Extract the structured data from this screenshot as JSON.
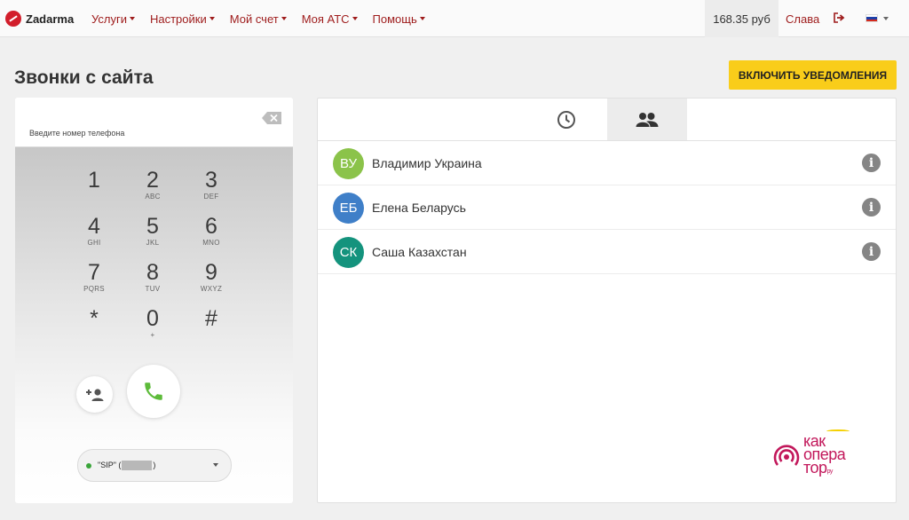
{
  "app": {
    "logo": "Zadarma",
    "nav": [
      "Услуги",
      "Настройки",
      "Мой счет",
      "Моя АТС",
      "Помощь"
    ],
    "balance": "168.35 руб",
    "user": "Слава",
    "flag_colors": [
      "#ffffff",
      "#1c3fa8",
      "#d52b1e"
    ]
  },
  "page": {
    "title": "Звонки с сайта",
    "notify_button": "ВКЛЮЧИТЬ УВЕДОМЛЕНИЯ"
  },
  "dialer": {
    "placeholder": "Введите номер телефона",
    "keys": [
      {
        "digit": "1",
        "letters": ""
      },
      {
        "digit": "2",
        "letters": "ABC"
      },
      {
        "digit": "3",
        "letters": "DEF"
      },
      {
        "digit": "4",
        "letters": "GHI"
      },
      {
        "digit": "5",
        "letters": "JKL"
      },
      {
        "digit": "6",
        "letters": "MNO"
      },
      {
        "digit": "7",
        "letters": "PQRS"
      },
      {
        "digit": "8",
        "letters": "TUV"
      },
      {
        "digit": "9",
        "letters": "WXYZ"
      },
      {
        "digit": "*",
        "letters": ""
      },
      {
        "digit": "0",
        "letters": "+"
      },
      {
        "digit": "#",
        "letters": ""
      }
    ],
    "sip_prefix": "\"SIP\" (",
    "sip_suffix": ")",
    "status_color": "#3aa53a",
    "call_color": "#5dbb3a"
  },
  "contacts": {
    "tabs": [
      {
        "icon": "clock-icon",
        "active": false
      },
      {
        "icon": "contacts-icon",
        "active": true
      }
    ],
    "items": [
      {
        "initials": "ВУ",
        "name": "Владимир Украина",
        "color": "#8bc34a"
      },
      {
        "initials": "ЕБ",
        "name": "Елена Беларусь",
        "color": "#3f7fc8"
      },
      {
        "initials": "СК",
        "name": "Саша Казахстан",
        "color": "#14937d"
      }
    ]
  },
  "watermark": {
    "lines": [
      "как",
      "опера",
      "тор"
    ],
    "suffix": "ру"
  }
}
